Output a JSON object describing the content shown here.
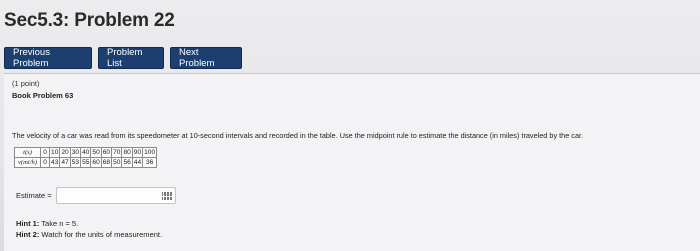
{
  "page": {
    "title": "Sec5.3: Problem 22"
  },
  "nav": {
    "prev": "Previous Problem",
    "list": "Problem List",
    "next": "Next Problem"
  },
  "problem": {
    "points": "(1 point)",
    "book": "Book Problem 63",
    "statement": "The velocity of a car was read from its speedometer at 10-second intervals and recorded in the table. Use the midpoint rule to estimate the distance (in miles) traveled by the car.",
    "table": {
      "row1_header": "t(s)",
      "row2_header": "v(mi/h)",
      "t": [
        "0",
        "10",
        "20",
        "30",
        "40",
        "50",
        "60",
        "70",
        "80",
        "90",
        "100"
      ],
      "v": [
        "0",
        "43",
        "47",
        "53",
        "55",
        "60",
        "68",
        "50",
        "56",
        "44",
        "36"
      ]
    },
    "estimate_label": "Estimate =",
    "estimate_value": "",
    "keypad_icon": "keypad-icon",
    "hint1_prefix": "Hint 1:",
    "hint1_text": " Take n = 5.",
    "hint2_prefix": "Hint 2:",
    "hint2_text": " Watch for the units of measurement."
  }
}
